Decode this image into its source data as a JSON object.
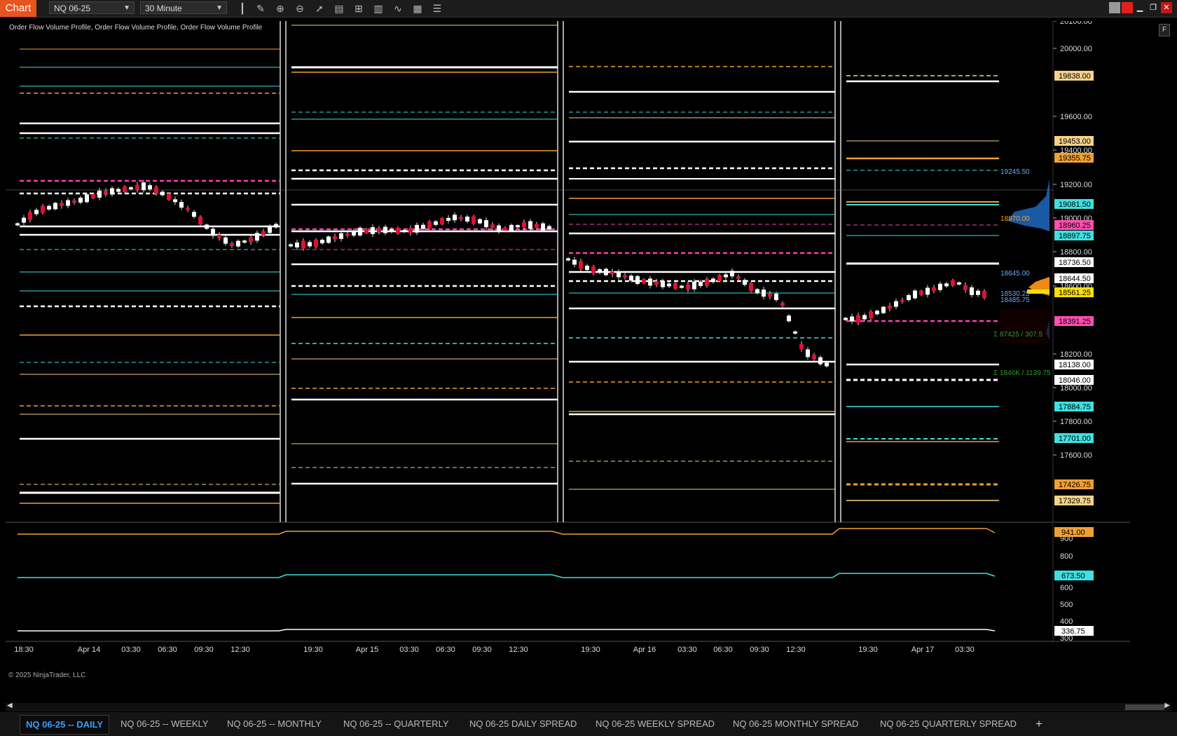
{
  "app": {
    "title": "Chart"
  },
  "toolbar": {
    "instrument": "NQ 06-25",
    "interval": "30 Minute",
    "icons": [
      "bar-type-icon",
      "pencil-icon",
      "zoom-in-icon",
      "zoom-out-icon",
      "cursor-icon",
      "data-box-icon",
      "properties-icon",
      "templates-icon",
      "strategies-icon",
      "indicators-icon",
      "list-icon"
    ]
  },
  "window_controls": [
    "minimize-icon",
    "maximize-icon",
    "close-icon"
  ],
  "chart": {
    "indicator_label": "Order Flow Volume Profile, Order Flow Volume Profile, Order Flow Volume Profile",
    "copyright": "© 2025 NinjaTrader, LLC",
    "f_button": "F",
    "price_ticks": [
      "20100.00",
      "20000.00",
      "19600.00",
      "19400.00",
      "19200.00",
      "19000.00",
      "18800.00",
      "18600.00",
      "18200.00",
      "18000.00",
      "17800.00",
      "17600.00"
    ],
    "price_badges": [
      {
        "label": "19838.00",
        "color": "#f5d28a"
      },
      {
        "label": "19453.00",
        "color": "#f5d28a"
      },
      {
        "label": "19355.75",
        "color": "#f0a030"
      },
      {
        "label": "19081.50",
        "color": "#3fe0e0"
      },
      {
        "label": "18960.25",
        "color": "#ff4fb0"
      },
      {
        "label": "18897.75",
        "color": "#3fe0e0"
      },
      {
        "label": "18736.50",
        "color": "#ffffff"
      },
      {
        "label": "18644.50",
        "color": "#ffffff"
      },
      {
        "label": "18561.25",
        "color": "#ffe000"
      },
      {
        "label": "18391.25",
        "color": "#ff4fb0"
      },
      {
        "label": "18138.00",
        "color": "#ffffff"
      },
      {
        "label": "18046.00",
        "color": "#ffffff"
      },
      {
        "label": "17884.75",
        "color": "#3fe0e0"
      },
      {
        "label": "17701.00",
        "color": "#3fe0e0"
      },
      {
        "label": "17426.75",
        "color": "#f0a030"
      },
      {
        "label": "17329.75",
        "color": "#f5d28a"
      }
    ],
    "profile_labels": [
      "19245.50",
      "18970.00",
      "18645.00",
      "18530.25",
      "18485.75",
      "Σ 87425 / 307.5",
      "Σ 1846K / 1139.75"
    ],
    "lower_ticks": [
      "900",
      "800",
      "600",
      "500",
      "400",
      "300"
    ],
    "lower_badges": [
      {
        "label": "941.00",
        "color": "#f0a030"
      },
      {
        "label": "673.50",
        "color": "#3fe0e0"
      },
      {
        "label": "336.75",
        "color": "#ffffff"
      }
    ],
    "time_labels": [
      "18:30",
      "Apr 14",
      "03:30",
      "06:30",
      "09:30",
      "12:30",
      "19:30",
      "Apr 15",
      "03:30",
      "06:30",
      "09:30",
      "12:30",
      "19:30",
      "Apr 16",
      "03:30",
      "06:30",
      "09:30",
      "12:30",
      "19:30",
      "Apr 17",
      "03:30"
    ],
    "colors": {
      "white": "#ffffff",
      "orange": "#f0a030",
      "tan": "#f5d28a",
      "cyan": "#3fe0e0",
      "magenta": "#ff3fb0",
      "candle_up": "#ffffff",
      "candle_down": "#e01030"
    }
  },
  "tabs": [
    {
      "label": "NQ 06-25 -- DAILY",
      "active": true
    },
    {
      "label": "NQ 06-25 -- WEEKLY",
      "active": false
    },
    {
      "label": "NQ 06-25 -- MONTHLY",
      "active": false
    },
    {
      "label": "NQ 06-25 -- QUARTERLY",
      "active": false
    },
    {
      "label": "NQ 06-25 DAILY SPREAD",
      "active": false
    },
    {
      "label": "NQ 06-25 WEEKLY SPREAD",
      "active": false
    },
    {
      "label": "NQ 06-25 MONTHLY SPREAD",
      "active": false
    },
    {
      "label": "NQ 06-25 QUARTERLY SPREAD",
      "active": false
    }
  ],
  "add_tab": "+"
}
